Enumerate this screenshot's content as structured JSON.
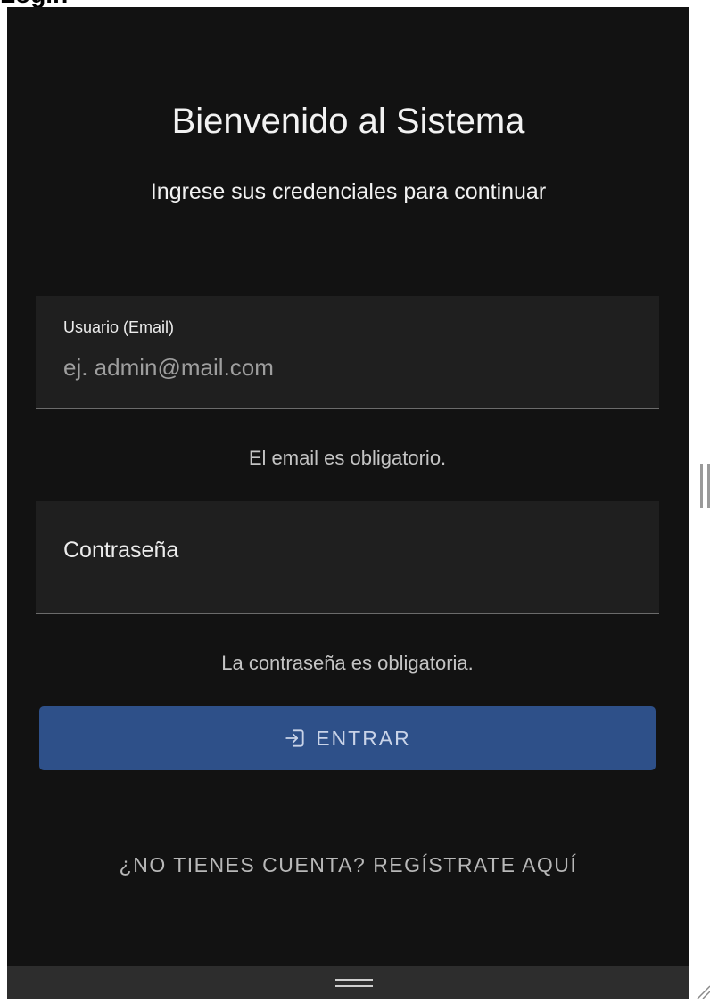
{
  "window": {
    "clipped_title": "Login"
  },
  "login": {
    "title": "Bienvenido al Sistema",
    "subtitle": "Ingrese sus credenciales para continuar",
    "email": {
      "label": "Usuario (Email)",
      "value": "",
      "placeholder": "ej. admin@mail.com",
      "error": "El email es obligatorio."
    },
    "password": {
      "label": "Contraseña",
      "value": "",
      "error": "La contraseña es obligatoria."
    },
    "submit_label": "ENTRAR",
    "register_link": "¿NO TIENES CUENTA? REGÍSTRATE AQUÍ"
  },
  "colors": {
    "background": "#121212",
    "field_background": "#1f1f1f",
    "primary_button": "#2e5089",
    "text": "#f2f2f2",
    "muted_text": "#c4c4c4"
  },
  "icons": {
    "submit": "login-icon",
    "splitter": "splitter-grip-icon",
    "bottom_grip": "drag-grip-icon",
    "corner": "resize-corner-icon"
  }
}
